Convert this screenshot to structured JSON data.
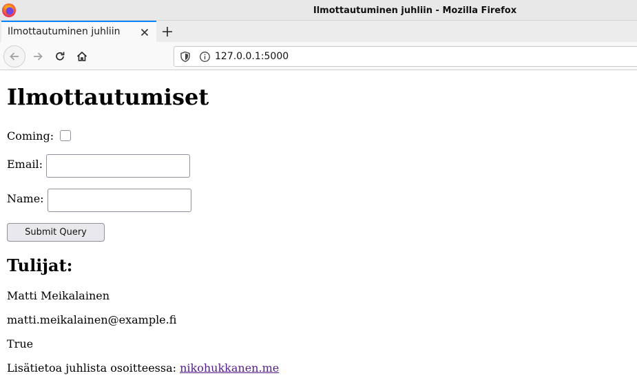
{
  "window": {
    "title": "Ilmottautuminen juhliin - Mozilla Firefox"
  },
  "tabs": [
    {
      "label": "Ilmottautuminen juhliin"
    }
  ],
  "navbar": {
    "url": "127.0.0.1:5000"
  },
  "page": {
    "heading": "Ilmottautumiset",
    "form": {
      "coming_label": "Coming:",
      "coming_checked": false,
      "email_label": "Email:",
      "email_value": "",
      "name_label": "Name:",
      "name_value": "",
      "submit_label": "Submit Query"
    },
    "attendees_heading": "Tulijat:",
    "attendees": [
      {
        "name": "Matti Meikalainen",
        "email": "matti.meikalainen@example.fi",
        "coming": "True"
      }
    ],
    "info_text": "Lisätietoa juhlista osoitteessa:",
    "info_link": "nikohukkanen.me"
  },
  "colors": {
    "accent": "#0a84ff",
    "visited_link": "#551a8b"
  }
}
